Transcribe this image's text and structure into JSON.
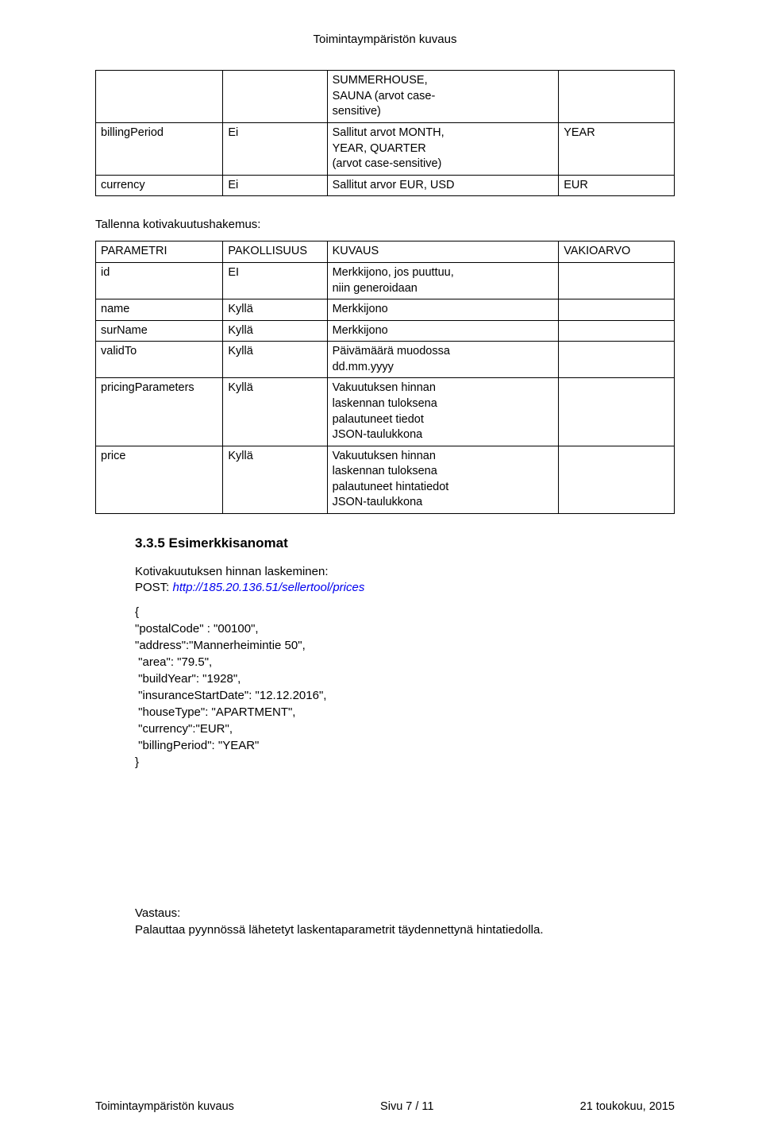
{
  "header": {
    "title": "Toimintaympäristön kuvaus"
  },
  "table1": {
    "rows": [
      {
        "c0": "",
        "c1": "",
        "c2": "SUMMERHOUSE,\nSAUNA (arvot case-\nsensitive)",
        "c3": ""
      },
      {
        "c0": "billingPeriod",
        "c1": "Ei",
        "c2": "Sallitut arvot MONTH,\nYEAR, QUARTER\n(arvot case-sensitive)",
        "c3": "YEAR"
      },
      {
        "c0": "currency",
        "c1": "Ei",
        "c2": "Sallitut arvor EUR, USD",
        "c3": "EUR"
      }
    ]
  },
  "section2_label": "Tallenna kotivakuutushakemus:",
  "table2": {
    "header": {
      "c0": "PARAMETRI",
      "c1": "PAKOLLISUUS",
      "c2": "KUVAUS",
      "c3": "VAKIOARVO"
    },
    "rows": [
      {
        "c0": "id",
        "c1": "EI",
        "c2": "Merkkijono, jos puuttuu,\nniin generoidaan",
        "c3": ""
      },
      {
        "c0": "name",
        "c1": "Kyllä",
        "c2": "Merkkijono",
        "c3": ""
      },
      {
        "c0": "surName",
        "c1": "Kyllä",
        "c2": "Merkkijono",
        "c3": ""
      },
      {
        "c0": "validTo",
        "c1": "Kyllä",
        "c2": "Päivämäärä muodossa\ndd.mm.yyyy",
        "c3": ""
      },
      {
        "c0": "pricingParameters",
        "c1": "Kyllä",
        "c2": "Vakuutuksen hinnan\nlaskennan tuloksena\npalautuneet tiedot\nJSON-taulukkona",
        "c3": ""
      },
      {
        "c0": "price",
        "c1": "Kyllä",
        "c2": "Vakuutuksen hinnan\nlaskennan tuloksena\npalautuneet hintatiedot\nJSON-taulukkona",
        "c3": ""
      }
    ]
  },
  "example": {
    "heading": "3.3.5  Esimerkkisanomat",
    "intro": "Kotivakuutuksen hinnan laskeminen:",
    "post_label": "POST:  ",
    "url": "http://185.20.136.51/sellertool/prices",
    "json_lines": [
      "{",
      "\"postalCode\" : \"00100\",",
      "\"address\":\"Mannerheimintie 50\",",
      " \"area\": \"79.5\",",
      " \"buildYear\": \"1928\",",
      " \"insuranceStartDate\": \"12.12.2016\",",
      " \"houseType\": \"APARTMENT\",",
      " \"currency\":\"EUR\",",
      " \"billingPeriod\": \"YEAR\"",
      "}"
    ]
  },
  "answer": {
    "label": "Vastaus:",
    "text": "Palauttaa pyynnössä lähetetyt laskentaparametrit täydennettynä hintatiedolla."
  },
  "footer": {
    "left": "Toimintaympäristön kuvaus",
    "center": "Sivu 7 / 11",
    "right": "21 toukokuu, 2015"
  }
}
